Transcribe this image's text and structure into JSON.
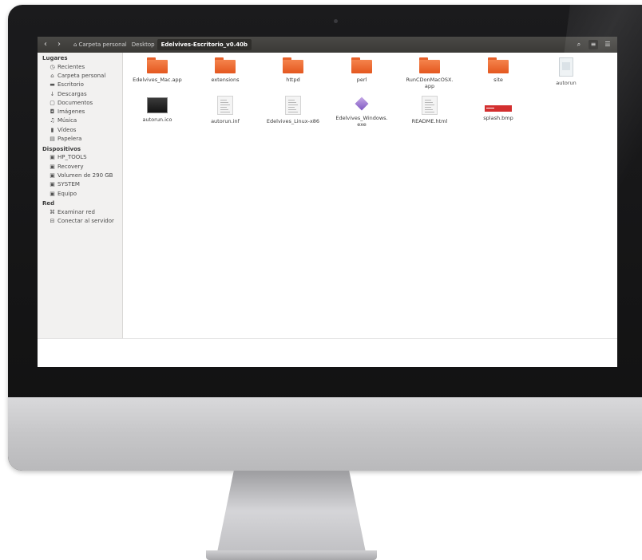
{
  "window": {
    "nav": {
      "back_icon": "chevron-left-icon",
      "forward_icon": "chevron-right-icon"
    },
    "breadcrumbs": [
      {
        "label": "Carpeta personal",
        "icon": "home-icon"
      },
      {
        "label": "Desktop"
      },
      {
        "label": "Edelvives-Escritorio_v0.40b",
        "current": true
      }
    ],
    "toolbar": {
      "search_icon": "search-icon",
      "list_icon": "list-view-icon",
      "menu_icon": "menu-icon"
    }
  },
  "sidebar": {
    "sections": [
      {
        "title": "Lugares",
        "items": [
          {
            "label": "Recientes",
            "icon": "clock-icon"
          },
          {
            "label": "Carpeta personal",
            "icon": "home-icon"
          },
          {
            "label": "Escritorio",
            "icon": "folder-icon"
          },
          {
            "label": "Descargas",
            "icon": "download-icon"
          },
          {
            "label": "Documentos",
            "icon": "document-icon"
          },
          {
            "label": "Imágenes",
            "icon": "camera-icon"
          },
          {
            "label": "Música",
            "icon": "music-icon"
          },
          {
            "label": "Vídeos",
            "icon": "film-icon"
          },
          {
            "label": "Papelera",
            "icon": "trash-icon"
          }
        ]
      },
      {
        "title": "Dispositivos",
        "items": [
          {
            "label": "HP_TOOLS",
            "icon": "drive-icon"
          },
          {
            "label": "Recovery",
            "icon": "drive-icon"
          },
          {
            "label": "Volumen de 290 GB",
            "icon": "drive-icon"
          },
          {
            "label": "SYSTEM",
            "icon": "drive-icon"
          },
          {
            "label": "Equipo",
            "icon": "drive-icon"
          }
        ]
      },
      {
        "title": "Red",
        "items": [
          {
            "label": "Examinar red",
            "icon": "network-icon"
          },
          {
            "label": "Conectar al servidor",
            "icon": "server-icon"
          }
        ]
      }
    ]
  },
  "files": [
    {
      "name": "Edelvives_Mac.app",
      "type": "folder"
    },
    {
      "name": "extensions",
      "type": "folder"
    },
    {
      "name": "httpd",
      "type": "folder"
    },
    {
      "name": "perl",
      "type": "folder"
    },
    {
      "name": "RunCDonMacOSX.\napp",
      "type": "folder"
    },
    {
      "name": "site",
      "type": "folder"
    },
    {
      "name": "autorun",
      "type": "autorun"
    },
    {
      "name": "autorun.ico",
      "type": "ico"
    },
    {
      "name": "autorun.inf",
      "type": "text"
    },
    {
      "name": "Edelvives_Linux-x86",
      "type": "text"
    },
    {
      "name": "Edelvives_Windows.\nexe",
      "type": "exe"
    },
    {
      "name": "README.html",
      "type": "text"
    },
    {
      "name": "splash.bmp",
      "type": "bmp"
    }
  ]
}
